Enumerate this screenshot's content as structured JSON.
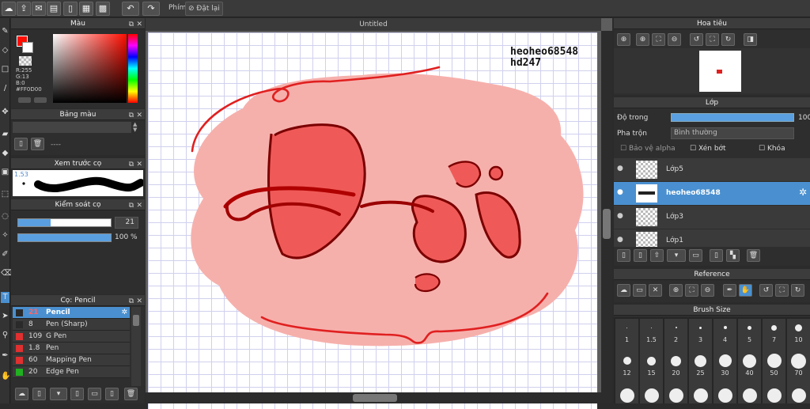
{
  "toolbar": {
    "keys_label": "Phím",
    "reset_label": "Đặt lại"
  },
  "color_panel": {
    "title": "Màu",
    "r_text": "R:255",
    "g_text": "G:13",
    "b_text": "B:0",
    "hex_text": "#FF0D00",
    "main_color": "#FF0D00"
  },
  "palette_panel": {
    "title": "Bảng màu",
    "dash": "----"
  },
  "preview_panel": {
    "title": "Xem trước cọ",
    "size_text": "1.53"
  },
  "brush_ctrl": {
    "title": "Kiểm soát cọ",
    "size_value": "21",
    "opacity_value": "100 %",
    "size_frac": 0.35,
    "opacity_frac": 1.0
  },
  "brush_list": {
    "title": "Cọ: Pencil",
    "items": [
      {
        "size": "21",
        "name": "Pencil",
        "color": "#2a2a2a"
      },
      {
        "size": "8",
        "name": "Pen (Sharp)",
        "color": "#2a2a2a"
      },
      {
        "size": "109",
        "name": "G Pen",
        "color": "#e03030"
      },
      {
        "size": "1.8",
        "name": "Pen",
        "color": "#e03030"
      },
      {
        "size": "60",
        "name": "Mapping Pen",
        "color": "#e03030"
      },
      {
        "size": "20",
        "name": "Edge Pen",
        "color": "#20b020"
      }
    ]
  },
  "document": {
    "title": "Untitled",
    "watermark_line1": "heoheo68548",
    "watermark_line2": "hd247"
  },
  "navigator": {
    "title": "Hoa tiêu"
  },
  "layers": {
    "title": "Lớp",
    "opacity_label": "Độ trong",
    "opacity_value": "100",
    "blend_label": "Pha trộn",
    "blend_value": "Bình thường",
    "alpha_label": "Bảo vệ alpha",
    "clip_label": "Xén bớt",
    "lock_label": "Khóa",
    "items": [
      {
        "name": "Lớp5"
      },
      {
        "name": "heoheo68548"
      },
      {
        "name": "Lớp3"
      },
      {
        "name": "Lớp1"
      }
    ]
  },
  "reference": {
    "title": "Reference"
  },
  "brush_size": {
    "title": "Brush Size",
    "row1": [
      "1",
      "1.5",
      "2",
      "3",
      "4",
      "5",
      "7",
      "10"
    ],
    "row2": [
      "12",
      "15",
      "20",
      "25",
      "30",
      "40",
      "50",
      "70"
    ]
  }
}
